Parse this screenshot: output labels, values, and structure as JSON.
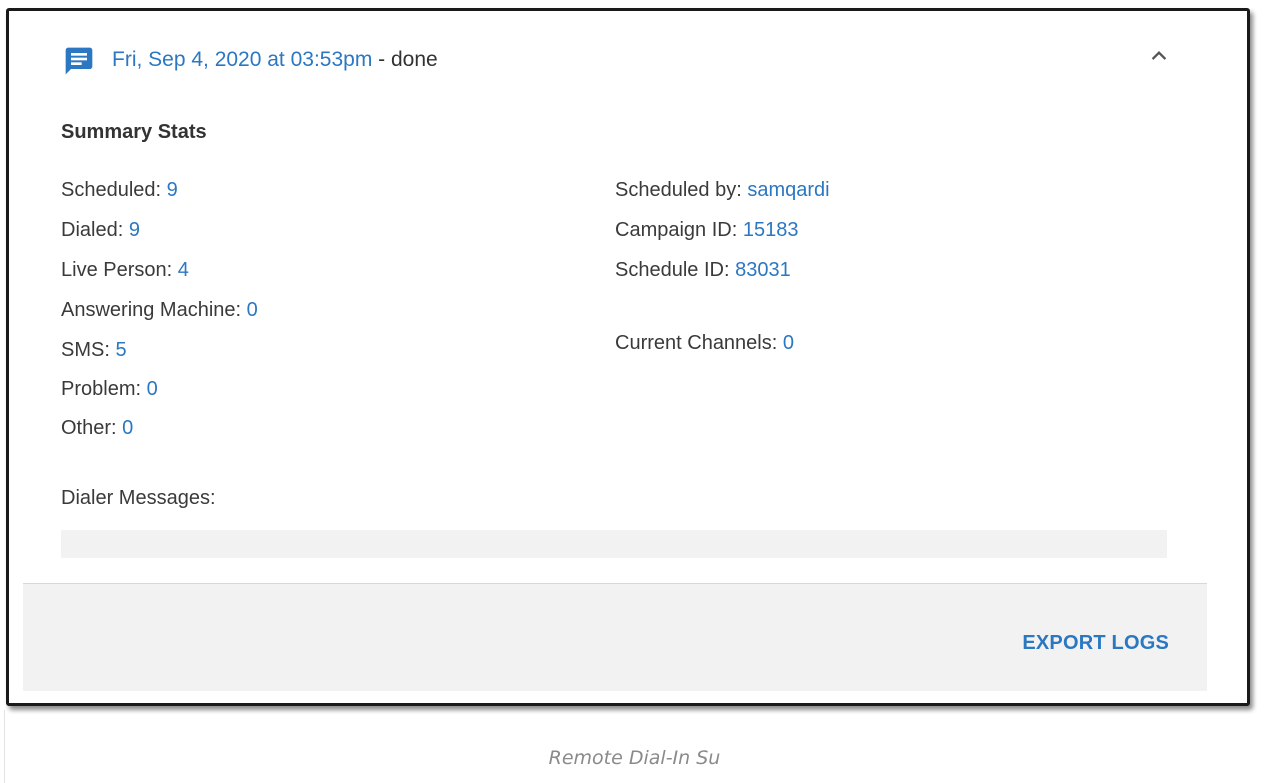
{
  "header": {
    "icon": "message-icon",
    "date": "Fri, Sep 4, 2020 at 03:53pm",
    "status": " - done",
    "collapse_icon": "chevron-up-icon"
  },
  "summary": {
    "title": "Summary Stats",
    "left": [
      {
        "label": "Scheduled: ",
        "value": "9"
      },
      {
        "label": "Dialed: ",
        "value": "9"
      },
      {
        "label": "Live Person: ",
        "value": "4"
      },
      {
        "label": "Answering Machine: ",
        "value": "0"
      },
      {
        "label": "SMS: ",
        "value": "5"
      },
      {
        "label": "Problem: ",
        "value": "0"
      },
      {
        "label": "Other: ",
        "value": "0"
      }
    ],
    "right": [
      {
        "label": "Scheduled by: ",
        "value": "samqardi"
      },
      {
        "label": "Campaign ID: ",
        "value": "15183"
      },
      {
        "label": "Schedule ID: ",
        "value": "83031"
      },
      {
        "label": "Current Channels: ",
        "value": "0"
      }
    ]
  },
  "dialer_messages": {
    "label": "Dialer Messages:"
  },
  "footer": {
    "export_label": "EXPORT LOGS"
  },
  "caption": "Remote Dial-In Su",
  "colors": {
    "accent": "#2b77c2",
    "text": "#333333",
    "footer_bg": "#f2f2f2"
  }
}
